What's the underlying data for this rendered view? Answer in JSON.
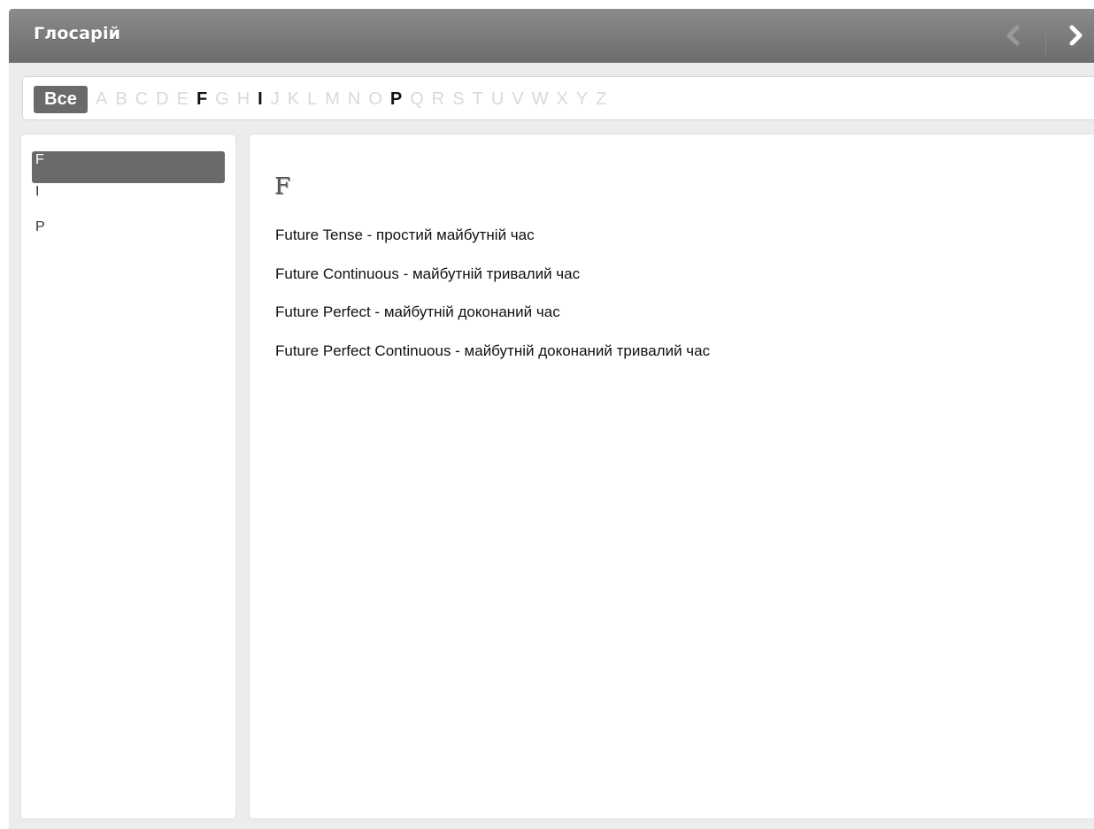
{
  "header": {
    "title": "Глосарій",
    "prev_icon": "chevron-left-icon",
    "next_icon": "chevron-right-icon"
  },
  "alphabet": {
    "all_label": "Все",
    "letters": [
      {
        "char": "A",
        "active": false
      },
      {
        "char": "B",
        "active": false
      },
      {
        "char": "C",
        "active": false
      },
      {
        "char": "D",
        "active": false
      },
      {
        "char": "E",
        "active": false
      },
      {
        "char": "F",
        "active": true
      },
      {
        "char": "G",
        "active": false
      },
      {
        "char": "H",
        "active": false
      },
      {
        "char": "I",
        "active": true
      },
      {
        "char": "J",
        "active": false
      },
      {
        "char": "K",
        "active": false
      },
      {
        "char": "L",
        "active": false
      },
      {
        "char": "M",
        "active": false
      },
      {
        "char": "N",
        "active": false
      },
      {
        "char": "O",
        "active": false
      },
      {
        "char": "P",
        "active": true
      },
      {
        "char": "Q",
        "active": false
      },
      {
        "char": "R",
        "active": false
      },
      {
        "char": "S",
        "active": false
      },
      {
        "char": "T",
        "active": false
      },
      {
        "char": "U",
        "active": false
      },
      {
        "char": "V",
        "active": false
      },
      {
        "char": "W",
        "active": false
      },
      {
        "char": "X",
        "active": false
      },
      {
        "char": "Y",
        "active": false
      },
      {
        "char": "Z",
        "active": false
      }
    ]
  },
  "sidebar": {
    "items": [
      {
        "label": "F",
        "selected": true
      },
      {
        "label": "I",
        "selected": false
      },
      {
        "label": "P",
        "selected": false
      }
    ]
  },
  "main": {
    "section_letter": "F",
    "entries": [
      "Future Tense - простий майбутній час",
      "Future Continuous - майбутній тривалий час",
      "Future Perfect - майбутній доконаний час",
      "Future Perfect Continuous - майбутній доконаний тривалий час"
    ]
  },
  "colors": {
    "header_bg": "#7b7979",
    "selected_bg": "#6b6969",
    "inactive_letter": "#d9d9d9",
    "active_letter": "#111111"
  }
}
